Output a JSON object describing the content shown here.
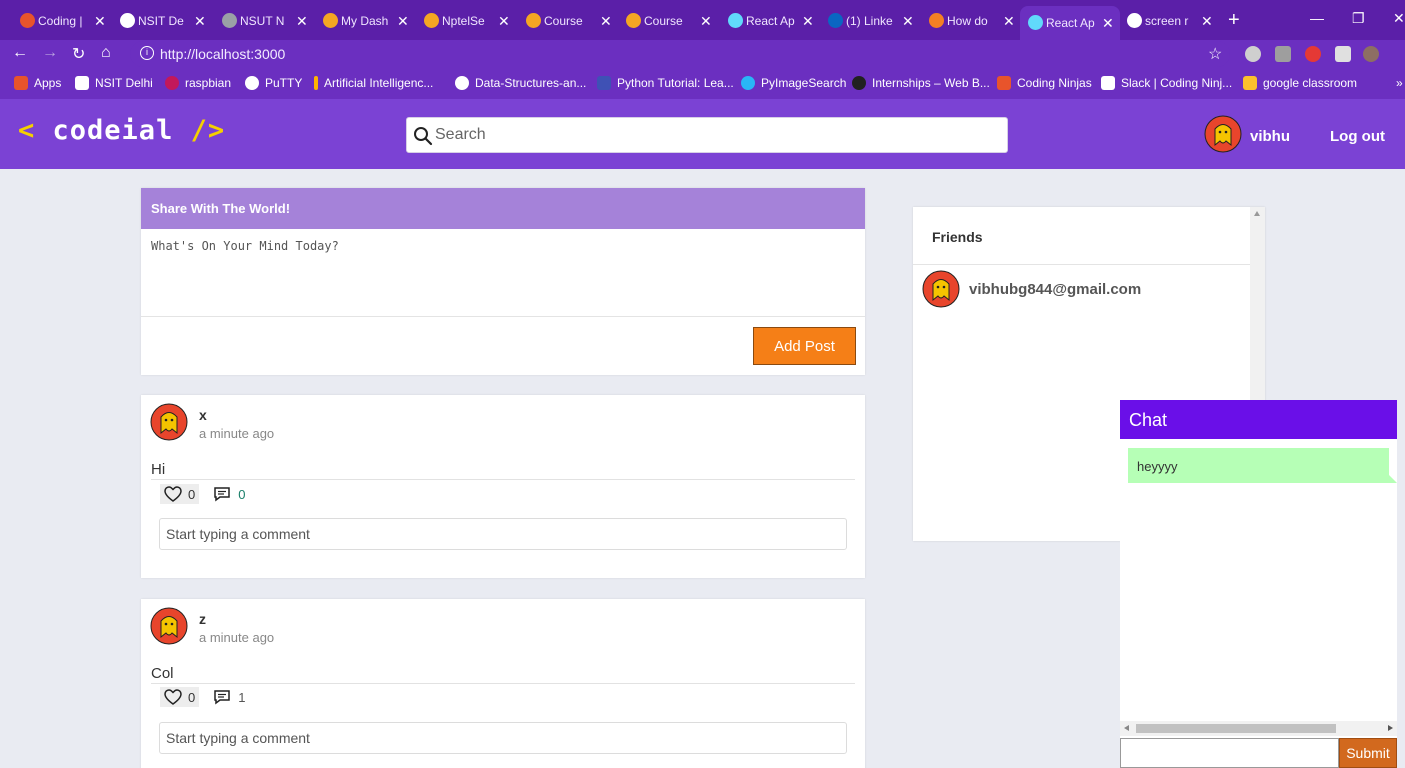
{
  "browser": {
    "tabs": [
      {
        "label": "Coding |",
        "color": "#e8542b"
      },
      {
        "label": "NSIT De",
        "color": "#ffffff"
      },
      {
        "label": "NSUT N",
        "color": "#9aa0a6"
      },
      {
        "label": "My Dash",
        "color": "#f5a623"
      },
      {
        "label": "NptelSe",
        "color": "#f5a623"
      },
      {
        "label": "Course",
        "color": "#f5a623"
      },
      {
        "label": "Course",
        "color": "#f5a623"
      },
      {
        "label": "React Ap",
        "color": "#61dafb"
      },
      {
        "label": "(1) Linke",
        "color": "#0a66c2"
      },
      {
        "label": "How do",
        "color": "#f48024"
      },
      {
        "label": "React Ap",
        "color": "#61dafb"
      },
      {
        "label": "screen r",
        "color": "#ffffff"
      }
    ],
    "url": "http://localhost:3000",
    "bookmarks": [
      {
        "label": "Apps"
      },
      {
        "label": "NSIT Delhi"
      },
      {
        "label": "raspbian"
      },
      {
        "label": "PuTTY"
      },
      {
        "label": "Artificial Intelligenc..."
      },
      {
        "label": "Data-Structures-an..."
      },
      {
        "label": "Python Tutorial: Lea..."
      },
      {
        "label": "PyImageSearch"
      },
      {
        "label": "Internships – Web B..."
      },
      {
        "label": "Coding Ninjas"
      },
      {
        "label": "Slack | Coding Ninj..."
      },
      {
        "label": "google classroom"
      }
    ]
  },
  "header": {
    "logo_open": "<",
    "logo_text": "codeial",
    "logo_close": "/>",
    "search_placeholder": "Search",
    "username": "vibhu",
    "logout": "Log out"
  },
  "create_post": {
    "title": "Share With The World!",
    "placeholder": "What's On Your Mind Today?",
    "button": "Add Post"
  },
  "posts": [
    {
      "author": "x",
      "time": "a minute ago",
      "content": "Hi",
      "likes": "0",
      "comments": "0",
      "comment_placeholder": "Start typing a comment"
    },
    {
      "author": "z",
      "time": "a minute ago",
      "content": "Col",
      "likes": "0",
      "comments": "1",
      "comment_placeholder": "Start typing a comment"
    }
  ],
  "friends": {
    "title": "Friends",
    "list": [
      {
        "email": "vibhubg844@gmail.com"
      }
    ]
  },
  "chat": {
    "title": "Chat",
    "messages": [
      {
        "text": "heyyyy"
      }
    ],
    "submit": "Submit"
  },
  "colors": {
    "header_bg": "#7b42d4",
    "accent_orange": "#f57f17",
    "chat_header": "#6a0fe8",
    "chat_bubble": "#b6ffb6"
  }
}
